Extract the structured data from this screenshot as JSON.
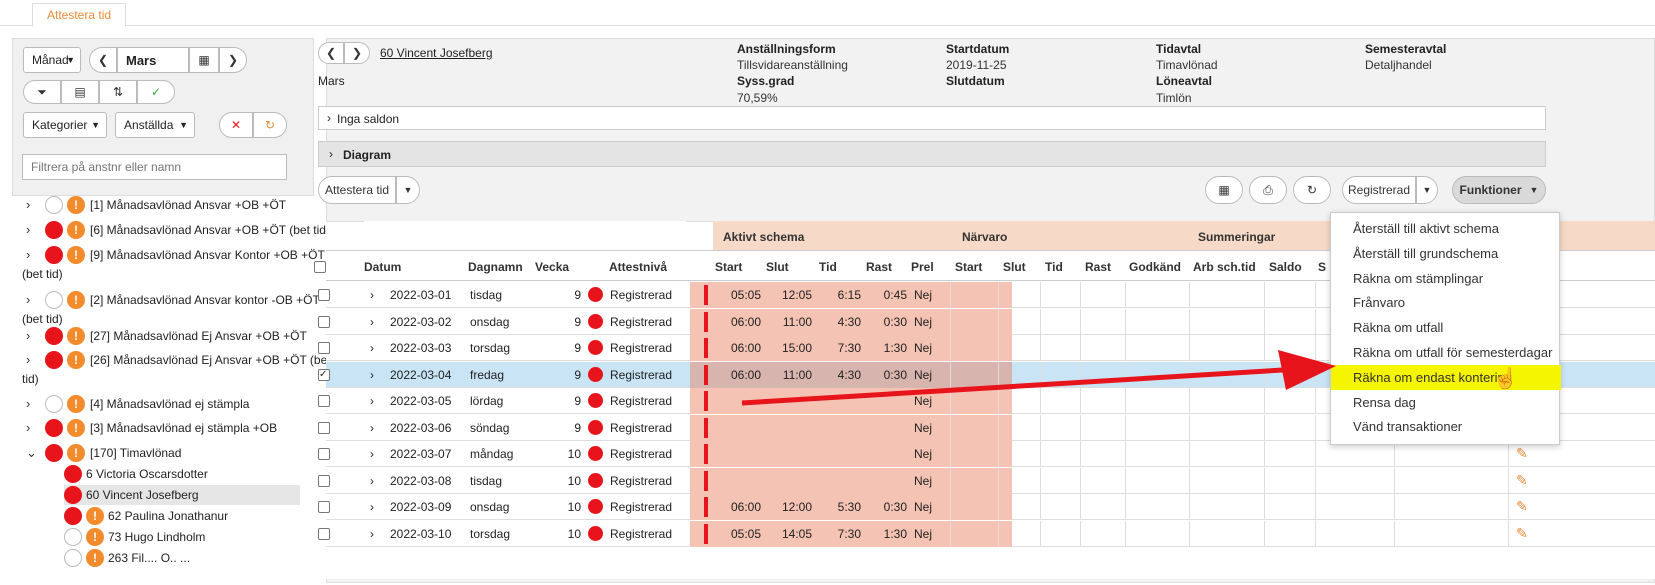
{
  "tab": "Attestera tid",
  "left": {
    "period_select": "Månad",
    "period_value": "Mars",
    "filter_categories": "Kategorier",
    "filter_employees": "Anställda",
    "search_placeholder": "Filtrera på anstnr eller namn",
    "tree": [
      {
        "label": "[1]  Månadsavlönad Ansvar +OB +ÖT",
        "dot": "white"
      },
      {
        "label": "[6]  Månadsavlönad Ansvar +OB +ÖT (bet tid)",
        "dot": "red"
      },
      {
        "label": "[9]  Månadsavlönad Ansvar Kontor +OB +ÖT",
        "label2": "(bet tid)",
        "dot": "red"
      },
      {
        "label": "[2]  Månadsavlönad Ansvar kontor -OB +ÖT",
        "label2": "(bet tid)",
        "dot": "white"
      },
      {
        "label": "[27]  Månadsavlönad Ej Ansvar +OB +ÖT",
        "dot": "red"
      },
      {
        "label": "[26]  Månadsavlönad Ej Ansvar +OB +ÖT (bet",
        "label2": "tid)",
        "dot": "red"
      },
      {
        "label": "[4]  Månadsavlönad ej stämpla",
        "dot": "white"
      },
      {
        "label": "[3]  Månadsavlönad ej stämpla +OB",
        "dot": "red"
      },
      {
        "label": "[170]  Timavlönad",
        "dot": "red"
      }
    ],
    "employees": [
      {
        "label": "6 Victoria Oscarsdotter"
      },
      {
        "label": "60 Vincent Josefberg"
      },
      {
        "label": "62 Paulina Jonathanur"
      },
      {
        "label": "73 Hugo Lindholm"
      },
      {
        "label": "263 Fil.... O.. ..."
      }
    ]
  },
  "header": {
    "employee": "60 Vincent Josefberg",
    "month": "Mars",
    "anst_lbl": "Anställningsform",
    "anst_val": "Tillsvidareanställning",
    "syss_lbl": "Syss.grad",
    "syss_val": "70,59%",
    "start_lbl": "Startdatum",
    "start_val": "2019-11-25",
    "slut_lbl": "Slutdatum",
    "tid_lbl": "Tidavtal",
    "tid_val": "Timavlönad",
    "lone_lbl": "Löneavtal",
    "lone_val": "Timlön",
    "sem_lbl": "Semesteravtal",
    "sem_val": "Detaljhandel",
    "saldon": "Inga saldon",
    "diagram": "Diagram"
  },
  "toolbar": {
    "attest": "Attestera tid",
    "status": "Registrerad",
    "functions": "Funktioner"
  },
  "groups": {
    "aktivt": "Aktivt schema",
    "narvaro": "Närvaro",
    "summ": "Summeringar"
  },
  "columns": {
    "datum": "Datum",
    "dagnamn": "Dagnamn",
    "vecka": "Vecka",
    "attest": "Attestnivå",
    "start": "Start",
    "slut": "Slut",
    "tid": "Tid",
    "rast": "Rast",
    "prel": "Prel",
    "nstart": "Start",
    "nslut": "Slut",
    "ntid": "Tid",
    "nrast": "Rast",
    "godkand": "Godkänd",
    "arb": "Arb sch.tid",
    "saldo": "Saldo",
    "s": "S"
  },
  "rows": [
    {
      "datum": "2022-03-01",
      "dag": "tisdag",
      "vecka": "9",
      "status": "Registrerad",
      "start": "05:05",
      "slut": "12:05",
      "tid": "6:15",
      "rast": "0:45",
      "prel": "Nej"
    },
    {
      "datum": "2022-03-02",
      "dag": "onsdag",
      "vecka": "9",
      "status": "Registrerad",
      "start": "06:00",
      "slut": "11:00",
      "tid": "4:30",
      "rast": "0:30",
      "prel": "Nej"
    },
    {
      "datum": "2022-03-03",
      "dag": "torsdag",
      "vecka": "9",
      "status": "Registrerad",
      "start": "06:00",
      "slut": "15:00",
      "tid": "7:30",
      "rast": "1:30",
      "prel": "Nej"
    },
    {
      "datum": "2022-03-04",
      "dag": "fredag",
      "vecka": "9",
      "status": "Registrerad",
      "start": "06:00",
      "slut": "11:00",
      "tid": "4:30",
      "rast": "0:30",
      "prel": "Nej"
    },
    {
      "datum": "2022-03-05",
      "dag": "lördag",
      "vecka": "9",
      "status": "Registrerad",
      "start": "",
      "slut": "",
      "tid": "",
      "rast": "",
      "prel": "Nej"
    },
    {
      "datum": "2022-03-06",
      "dag": "söndag",
      "vecka": "9",
      "status": "Registrerad",
      "start": "",
      "slut": "",
      "tid": "",
      "rast": "",
      "prel": "Nej"
    },
    {
      "datum": "2022-03-07",
      "dag": "måndag",
      "vecka": "10",
      "status": "Registrerad",
      "start": "",
      "slut": "",
      "tid": "",
      "rast": "",
      "prel": "Nej"
    },
    {
      "datum": "2022-03-08",
      "dag": "tisdag",
      "vecka": "10",
      "status": "Registrerad",
      "start": "",
      "slut": "",
      "tid": "",
      "rast": "",
      "prel": "Nej"
    },
    {
      "datum": "2022-03-09",
      "dag": "onsdag",
      "vecka": "10",
      "status": "Registrerad",
      "start": "06:00",
      "slut": "12:00",
      "tid": "5:30",
      "rast": "0:30",
      "prel": "Nej"
    },
    {
      "datum": "2022-03-10",
      "dag": "torsdag",
      "vecka": "10",
      "status": "Registrerad",
      "start": "05:05",
      "slut": "14:05",
      "tid": "7:30",
      "rast": "1:30",
      "prel": "Nej"
    }
  ],
  "menu": [
    "Återställ till aktivt schema",
    "Återställ till grundschema",
    "Räkna om stämplingar",
    "Frånvaro",
    "Räkna om utfall",
    "Räkna om utfall för semesterdagar",
    "Räkna om endast kontering",
    "Rensa dag",
    "Vänd transaktioner"
  ],
  "colors": {
    "accent": "#e98b3a",
    "pink": "#f4c3b3",
    "selected": "#c8e4f5",
    "highlight": "#f5f500",
    "red": "#e8141b"
  }
}
